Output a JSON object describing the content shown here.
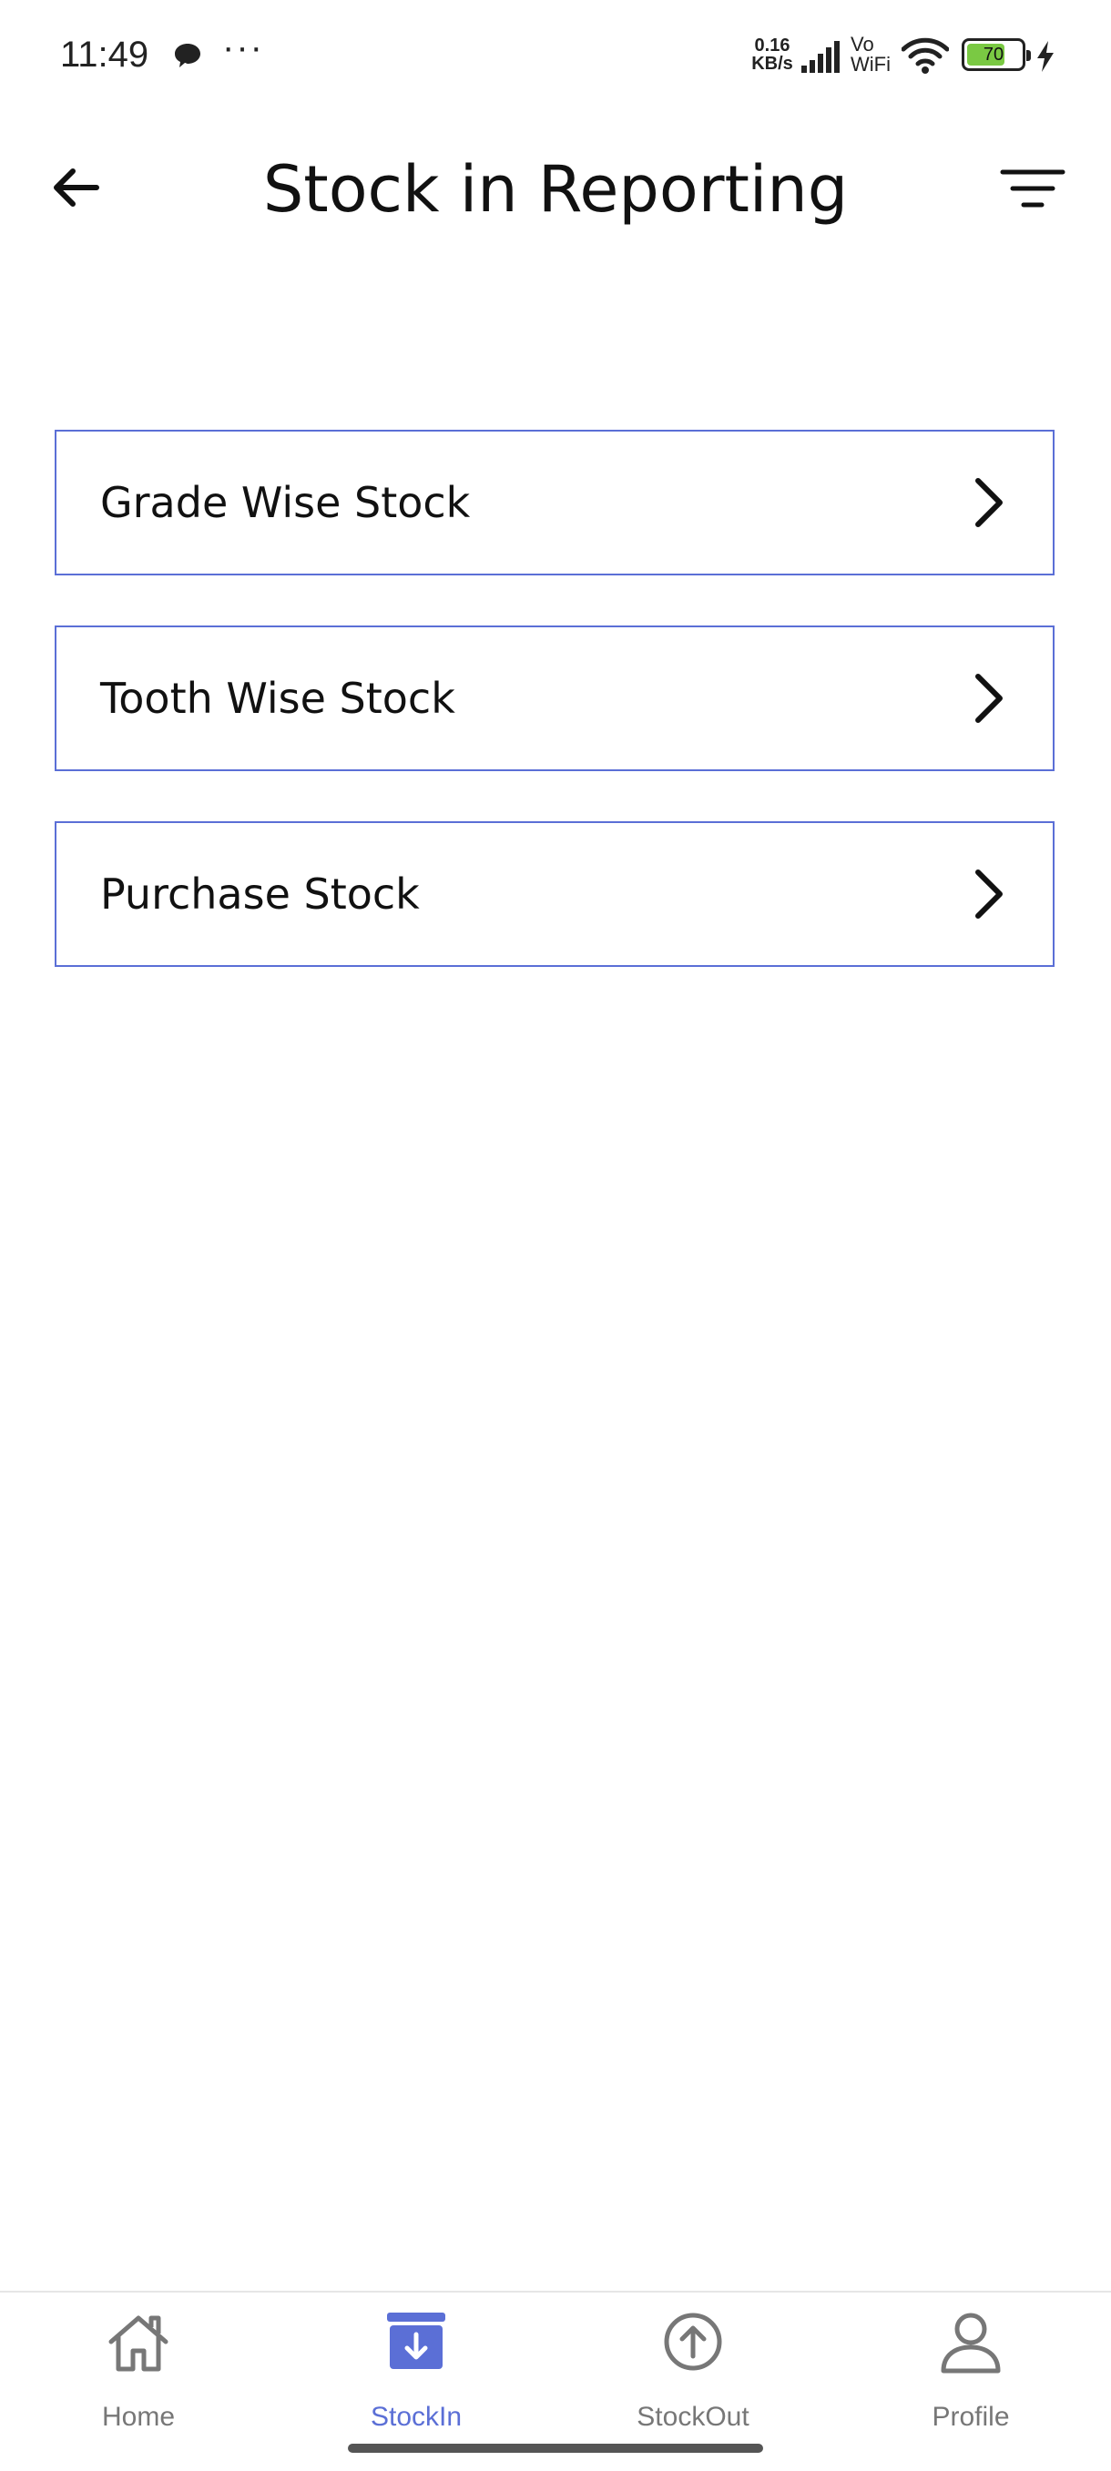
{
  "status_bar": {
    "time": "11:49",
    "more": "···",
    "speed_value": "0.16",
    "speed_unit": "KB/s",
    "vo": "Vo",
    "wifi_label": "WiFi",
    "battery_level": "70",
    "battery_fraction": 0.7,
    "battery_color": "#7ac943"
  },
  "header": {
    "title": "Stock in Reporting",
    "back_icon": "arrow-left-icon",
    "filter_icon": "filter-icon"
  },
  "menu": {
    "items": [
      {
        "label": "Grade Wise Stock"
      },
      {
        "label": "Tooth Wise Stock"
      },
      {
        "label": "Purchase Stock"
      }
    ],
    "border_color": "#5b6fd6"
  },
  "bottom_nav": {
    "items": [
      {
        "label": "Home",
        "icon": "home-icon",
        "active": false
      },
      {
        "label": "StockIn",
        "icon": "stock-in-icon",
        "active": true
      },
      {
        "label": "StockOut",
        "icon": "stock-out-icon",
        "active": false
      },
      {
        "label": "Profile",
        "icon": "profile-icon",
        "active": false
      }
    ],
    "active_color": "#5b6fd6",
    "inactive_color": "#777777"
  }
}
